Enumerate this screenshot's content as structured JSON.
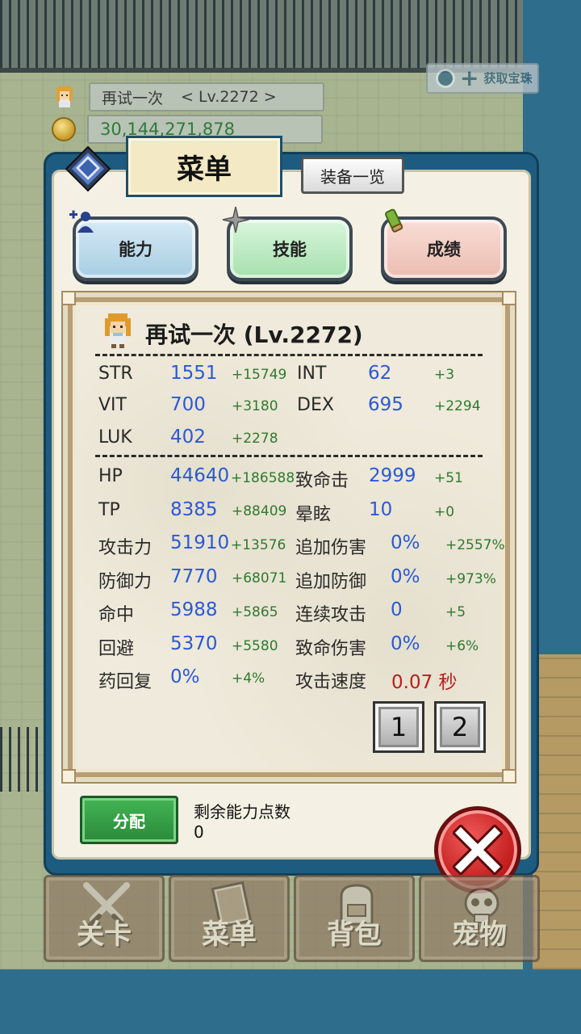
{
  "hud": {
    "player_name": "再试一次",
    "player_level": "< Lv.2272 >",
    "gold": "30,144,271,878",
    "bonus_text": "获取宝珠"
  },
  "menu": {
    "title": "菜单",
    "equip_button": "装备一览",
    "tabs": [
      {
        "label": "能力",
        "icon": "add-person-icon"
      },
      {
        "label": "技能",
        "icon": "sparkle-icon"
      },
      {
        "label": "成绩",
        "icon": "scroll-icon"
      }
    ]
  },
  "character": {
    "name_line": "再试一次 (Lv.2272)"
  },
  "base_stats": [
    {
      "label": "STR",
      "value": "1551",
      "bonus": "+15749"
    },
    {
      "label": "INT",
      "value": "62",
      "bonus": "+3"
    },
    {
      "label": "VIT",
      "value": "700",
      "bonus": "+3180"
    },
    {
      "label": "DEX",
      "value": "695",
      "bonus": "+2294"
    },
    {
      "label": "LUK",
      "value": "402",
      "bonus": "+2278"
    }
  ],
  "combat_left": [
    {
      "label": "HP",
      "value": "44640",
      "bonus": "+186588"
    },
    {
      "label": "TP",
      "value": "8385",
      "bonus": "+88409"
    },
    {
      "label": "攻击力",
      "value": "51910",
      "bonus": "+13576"
    },
    {
      "label": "防御力",
      "value": "7770",
      "bonus": "+68071"
    },
    {
      "label": "命中",
      "value": "5988",
      "bonus": "+5865"
    },
    {
      "label": "回避",
      "value": "5370",
      "bonus": "+5580"
    },
    {
      "label": "药回复",
      "value": "0%",
      "bonus": "+4%"
    }
  ],
  "combat_right": [
    {
      "label": "致命击",
      "value": "2999",
      "bonus": "+51"
    },
    {
      "label": "晕眩",
      "value": "10",
      "bonus": "+0"
    },
    {
      "label": "追加伤害",
      "value": "0%",
      "bonus": "+2557%"
    },
    {
      "label": "追加防御",
      "value": "0%",
      "bonus": "+973%"
    },
    {
      "label": "连续攻击",
      "value": "0",
      "bonus": "+5"
    },
    {
      "label": "致命伤害",
      "value": "0%",
      "bonus": "+6%"
    },
    {
      "label": "攻击速度",
      "value": "0.07 秒",
      "bonus": ""
    }
  ],
  "pages": [
    "1",
    "2"
  ],
  "points": {
    "assign_button": "分配",
    "remaining_label": "剩余能力点数",
    "remaining_value": "0"
  },
  "nav": [
    {
      "label": "关卡",
      "icon": "crossed-swords-icon"
    },
    {
      "label": "菜单",
      "icon": "book-icon"
    },
    {
      "label": "背包",
      "icon": "backpack-icon"
    },
    {
      "label": "宠物",
      "icon": "pet-skull-icon"
    }
  ],
  "colors": {
    "stat_value": "#2b59d6",
    "stat_bonus": "#2f7a2f",
    "attack_speed": "#b81e1e",
    "panel_frame": "#1d5c80"
  }
}
